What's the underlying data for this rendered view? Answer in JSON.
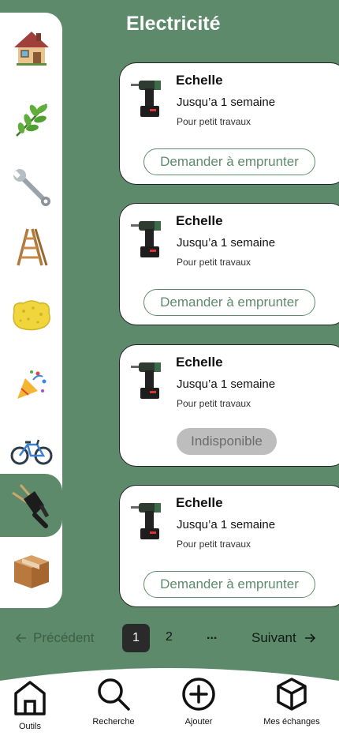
{
  "header": {
    "title": "Electricité"
  },
  "sidebar": {
    "items": [
      {
        "icon": "house-icon",
        "label": "Maison"
      },
      {
        "icon": "leaf-icon",
        "label": "Jardin"
      },
      {
        "icon": "wrench-icon",
        "label": "Outils"
      },
      {
        "icon": "ladder-icon",
        "label": "Echelles"
      },
      {
        "icon": "sponge-icon",
        "label": "Nettoyage"
      },
      {
        "icon": "party-popper-icon",
        "label": "Fête"
      },
      {
        "icon": "bicycle-icon",
        "label": "Vélo"
      },
      {
        "icon": "plug-icon",
        "label": "Electricité",
        "active": true
      },
      {
        "icon": "box-icon",
        "label": "Divers"
      }
    ]
  },
  "cards": [
    {
      "name": "Echelle",
      "duration": "Jusqu’a 1 semaine",
      "description": "Pour petit travaux",
      "action": "Demander à emprunter",
      "available": true
    },
    {
      "name": "Echelle",
      "duration": "Jusqu’a 1 semaine",
      "description": "Pour petit travaux",
      "action": "Demander à emprunter",
      "available": true
    },
    {
      "name": "Echelle",
      "duration": "Jusqu’a 1 semaine",
      "description": "Pour petit travaux",
      "action": "Indisponible",
      "available": false
    },
    {
      "name": "Echelle",
      "duration": "Jusqu’a 1 semaine",
      "description": "Pour petit travaux",
      "action": "Demander à emprunter",
      "available": true
    }
  ],
  "pagination": {
    "previous": "Précédent",
    "next": "Suivant",
    "current": "1",
    "page2": "2",
    "ellipsis": "..."
  },
  "bottom_nav": {
    "items": [
      {
        "icon": "home-icon",
        "label": "Outils"
      },
      {
        "icon": "search-icon",
        "label": "Recherche"
      },
      {
        "icon": "plus-circle-icon",
        "label": "Ajouter"
      },
      {
        "icon": "cube-icon",
        "label": "Mes échanges"
      }
    ]
  },
  "colors": {
    "background": "#5e8a6c",
    "accent": "#5e8a6c",
    "card": "#ffffff",
    "disabled": "#bdbdbd"
  }
}
